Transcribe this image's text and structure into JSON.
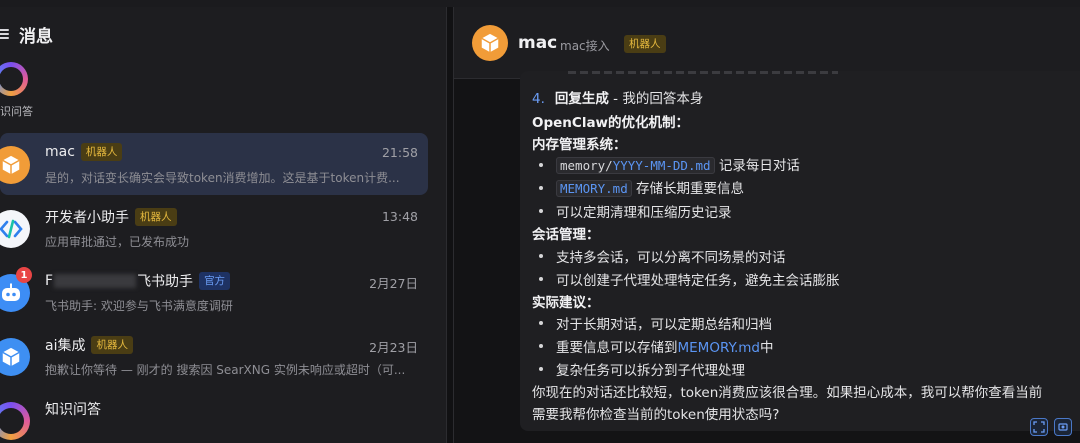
{
  "sidebar": {
    "title": "消息",
    "story_label": "识问答",
    "items": [
      {
        "name": "mac",
        "tag": "机器人",
        "time": "21:58",
        "preview": "是的，对话变长确实会导致token消费增加。这是基于token计费..."
      },
      {
        "name": "开发者小助手",
        "tag": "机器人",
        "time": "13:48",
        "preview": "应用审批通过，已发布成功"
      },
      {
        "name_prefix": "F",
        "name_suffix": "飞书助手",
        "tag": "官方",
        "badge": "1",
        "time": "2月27日",
        "preview": "飞书助手: 欢迎参与飞书满意度调研"
      },
      {
        "name": "ai集成",
        "tag": "机器人",
        "time": "2月23日",
        "preview": "抱歉让你等待 — 刚才的 搜索因 SearXNG 实例未响应或超时（可..."
      },
      {
        "name": "知识问答"
      }
    ]
  },
  "chat": {
    "name": "mac",
    "subtitle": "mac接入",
    "tag": "机器人",
    "lines": {
      "step_num": "4.",
      "step_bold": "回复生成",
      "step_rest": " - 我的回答本身",
      "h1": "OpenClaw的优化机制：",
      "h2": "内存管理系统：",
      "b1_code_a": "memory/",
      "b1_code_b": "YYYY-MM-DD.md",
      "b1_rest": " 记录每日对话",
      "b2_code": "MEMORY.md",
      "b2_rest": " 存储长期重要信息",
      "b3": "可以定期清理和压缩历史记录",
      "h3": "会话管理：",
      "b4": "支持多会话，可以分离不同场景的对话",
      "b5": "可以创建子代理处理特定任务，避免主会话膨胀",
      "h4": "实际建议：",
      "b6": "对于长期对话，可以定期总结和归档",
      "b7_a": "重要信息可以存储到",
      "b7_link": "MEMORY.md",
      "b7_b": "中",
      "b8": "复杂任务可以拆分到子代理处理",
      "p1": "你现在的对话还比较短，token消费应该很合理。如果担心成本，我可以帮你查看当前",
      "p2": "需要我帮你检查当前的token使用状态吗?"
    }
  }
}
